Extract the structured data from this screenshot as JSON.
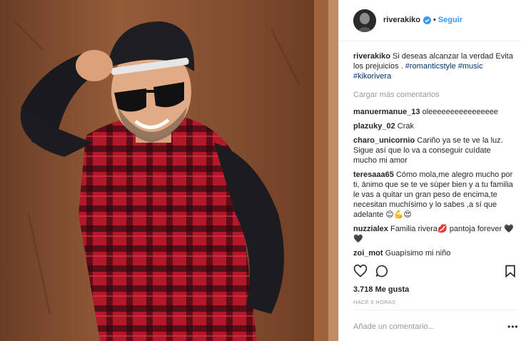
{
  "post": {
    "username": "riverakiko",
    "follow_label": "Seguir",
    "dot": "•",
    "caption_user": "riverakiko",
    "caption_text": "Si deseas alcanzar la verdad Evita los prejuicios .",
    "hashtags": [
      "#romanticstyle",
      "#music",
      "#kikorivera"
    ],
    "load_more": "Cargar más comentarios",
    "comments": [
      {
        "user": "manuermanue_13",
        "text": "oleeeeeeeeeeeeeeee"
      },
      {
        "user": "plazuky_02",
        "text": "Crak"
      },
      {
        "user": "charo_unicornio",
        "text": "Cariño ya se te ve la luz. Sigue así que lo va a conseguir cuídate mucho mi amor"
      },
      {
        "user": "teresaaa65",
        "text": "Cómo mola,me alegro mucho por ti, ánimo que se te ve súper bien y a tu familia le vas a quitar un gran peso de encima,te necesitan muchísimo y lo sabes ,a sí que adelante 😊💪😍"
      },
      {
        "user": "nuzzialex",
        "text": "Familia rivera💋 pantoja forever 🖤🖤"
      },
      {
        "user": "zoi_mot",
        "text": "Guapísimo mi niño"
      }
    ],
    "likes": "3.718 Me gusta",
    "time": "HACE 6 HORAS",
    "add_comment_placeholder": "Añade un comentario...",
    "more_label": "•••"
  },
  "icons": {
    "like": "heart-outline-icon",
    "comment": "speech-bubble-icon",
    "save": "bookmark-icon",
    "verified": "verified-badge-icon"
  },
  "colors": {
    "link": "#3897f0",
    "hashtag": "#003569",
    "muted": "#999999",
    "text": "#262626",
    "verified": "#3897f0"
  }
}
